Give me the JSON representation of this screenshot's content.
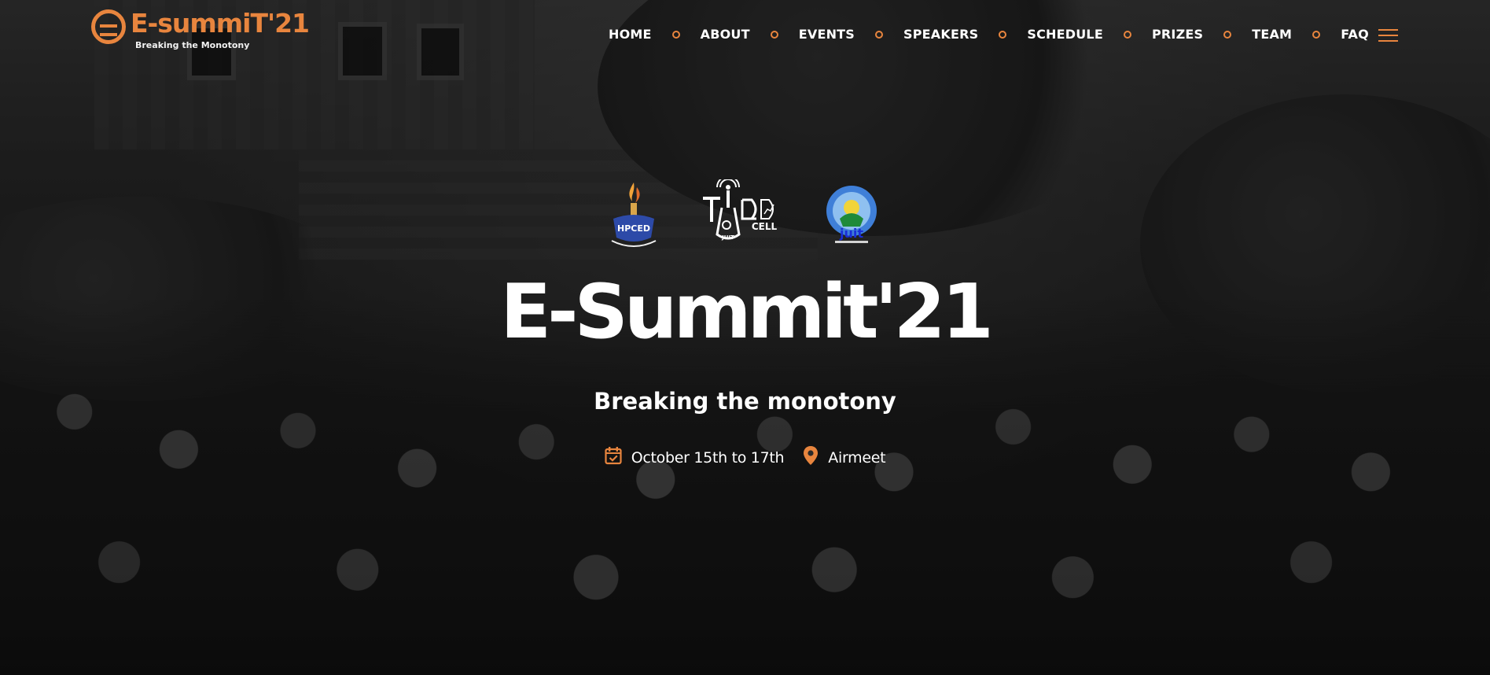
{
  "brand": {
    "logo_title": "E-summiT'21",
    "logo_tagline": "Breaking the Monotony"
  },
  "nav": {
    "items": [
      {
        "label": "HOME"
      },
      {
        "label": "ABOUT"
      },
      {
        "label": "EVENTS"
      },
      {
        "label": "SPEAKERS"
      },
      {
        "label": "SCHEDULE"
      },
      {
        "label": "PRIZES"
      },
      {
        "label": "TEAM"
      },
      {
        "label": "FAQ"
      }
    ],
    "menu_icon": "hamburger-menu-icon"
  },
  "sponsors": {
    "hpced": "HPCED",
    "tied": "TIED CELL",
    "tied_sub": "JUIT",
    "juit": "juit"
  },
  "hero": {
    "title": "E-Summit'21",
    "subtitle": "Breaking the monotony",
    "date": "October 15th to 17th",
    "venue": "Airmeet"
  },
  "colors": {
    "accent": "#e8853e",
    "text": "#ffffff",
    "background": "#1e1e1e"
  }
}
